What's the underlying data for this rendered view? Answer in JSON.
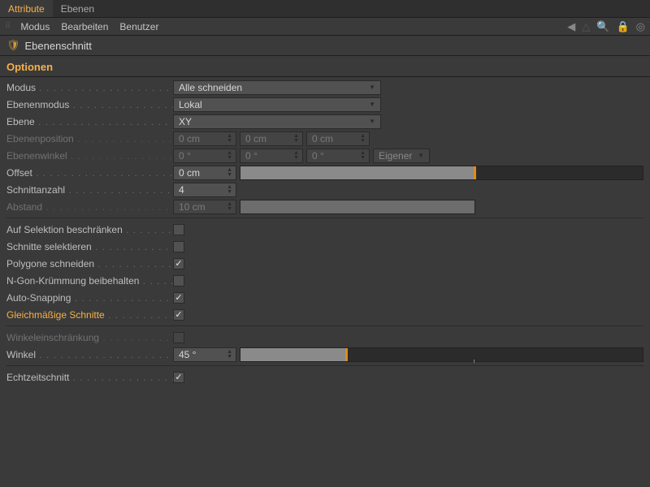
{
  "tabs": {
    "attribute": "Attribute",
    "ebenen": "Ebenen"
  },
  "menubar": {
    "modus": "Modus",
    "bearbeiten": "Bearbeiten",
    "benutzer": "Benutzer"
  },
  "title": "Ebenenschnitt",
  "section": "Optionen",
  "fields": {
    "modus": {
      "label": "Modus",
      "value": "Alle schneiden"
    },
    "ebenenmodus": {
      "label": "Ebenenmodus",
      "value": "Lokal"
    },
    "ebene": {
      "label": "Ebene",
      "value": "XY"
    },
    "ebenenposition": {
      "label": "Ebenenposition",
      "x": "0 cm",
      "y": "0 cm",
      "z": "0 cm"
    },
    "ebenenwinkel": {
      "label": "Ebenenwinkel",
      "x": "0 °",
      "y": "0 °",
      "z": "0 °",
      "mode": "Eigener"
    },
    "offset": {
      "label": "Offset",
      "value": "0 cm"
    },
    "schnittanzahl": {
      "label": "Schnittanzahl",
      "value": "4"
    },
    "abstand": {
      "label": "Abstand",
      "value": "10 cm"
    },
    "auf_selektion": {
      "label": "Auf Selektion beschränken",
      "checked": false
    },
    "schnitte_selektieren": {
      "label": "Schnitte selektieren",
      "checked": false
    },
    "polygone_schneiden": {
      "label": "Polygone schneiden",
      "checked": true
    },
    "ngon": {
      "label": "N-Gon-Krümmung beibehalten",
      "checked": false
    },
    "auto_snapping": {
      "label": "Auto-Snapping",
      "checked": true
    },
    "gleichmaessig": {
      "label": "Gleichmäßige Schnitte",
      "checked": true
    },
    "winkeleinschraenkung": {
      "label": "Winkeleinschränkung",
      "checked": false
    },
    "winkel": {
      "label": "Winkel",
      "value": "45 °"
    },
    "echtzeitschnitt": {
      "label": "Echtzeitschnitt",
      "checked": true
    }
  }
}
